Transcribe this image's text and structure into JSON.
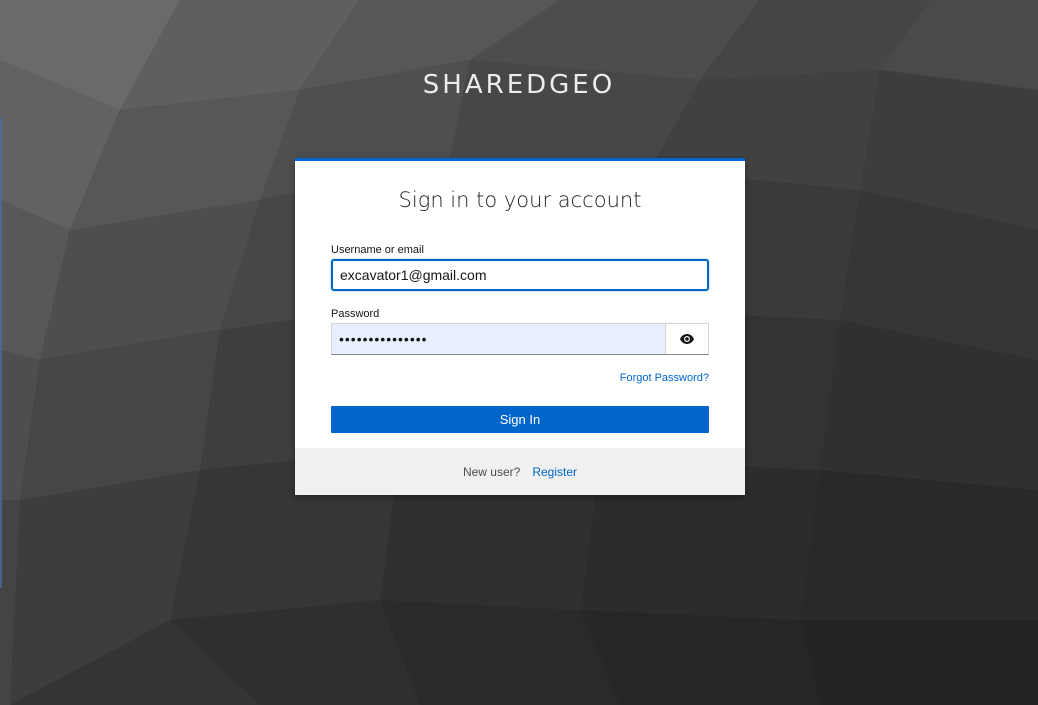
{
  "brand": {
    "name": "SHAREDGEO"
  },
  "login": {
    "title": "Sign in to your account",
    "username_label": "Username or email",
    "username_value": "excavator1@gmail.com",
    "password_label": "Password",
    "password_value": "•••••••••••••••",
    "reveal_icon": "eye-icon",
    "forgot_password": "Forgot Password?",
    "sign_in_label": "Sign In"
  },
  "footer": {
    "new_user_text": "New user?",
    "register_label": "Register"
  },
  "colors": {
    "accent": "#0066cc",
    "background": "#3a3a3a",
    "autofill": "#e8f0fe",
    "footer_bg": "#f0f0f0"
  }
}
